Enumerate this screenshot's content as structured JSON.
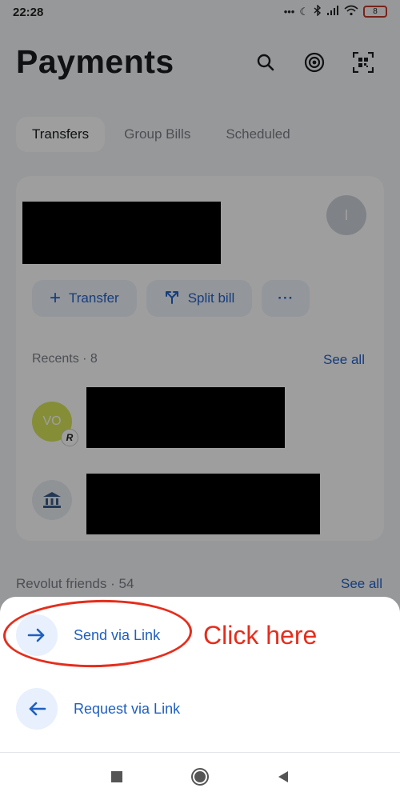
{
  "status_bar": {
    "time": "22:28",
    "battery": "8"
  },
  "header": {
    "title": "Payments",
    "icons": [
      "search-icon",
      "hotspot-icon",
      "qr-code-icon"
    ]
  },
  "tabs": [
    {
      "label": "Transfers",
      "active": true
    },
    {
      "label": "Group Bills",
      "active": false
    },
    {
      "label": "Scheduled",
      "active": false
    }
  ],
  "account_card": {
    "avatar_initial": "I",
    "actions": {
      "transfer": "Transfer",
      "split_bill": "Split bill",
      "more": "···"
    },
    "recents_label": "Recents · 8",
    "recents_see_all": "See all",
    "recents": [
      {
        "initials": "VO",
        "badge": "R"
      },
      {
        "icon": "bank-icon"
      }
    ]
  },
  "friends": {
    "label": "Revolut friends · 54",
    "see_all": "See all"
  },
  "sheet": {
    "items": [
      {
        "label": "Send via Link",
        "icon": "arrow-right-icon"
      },
      {
        "label": "Request via Link",
        "icon": "arrow-left-icon"
      }
    ]
  },
  "annotation": {
    "text": "Click here",
    "color": "#e52d1c"
  },
  "colors": {
    "accent": "#2563c9",
    "dim": "rgba(0,0,0,0.38)"
  }
}
